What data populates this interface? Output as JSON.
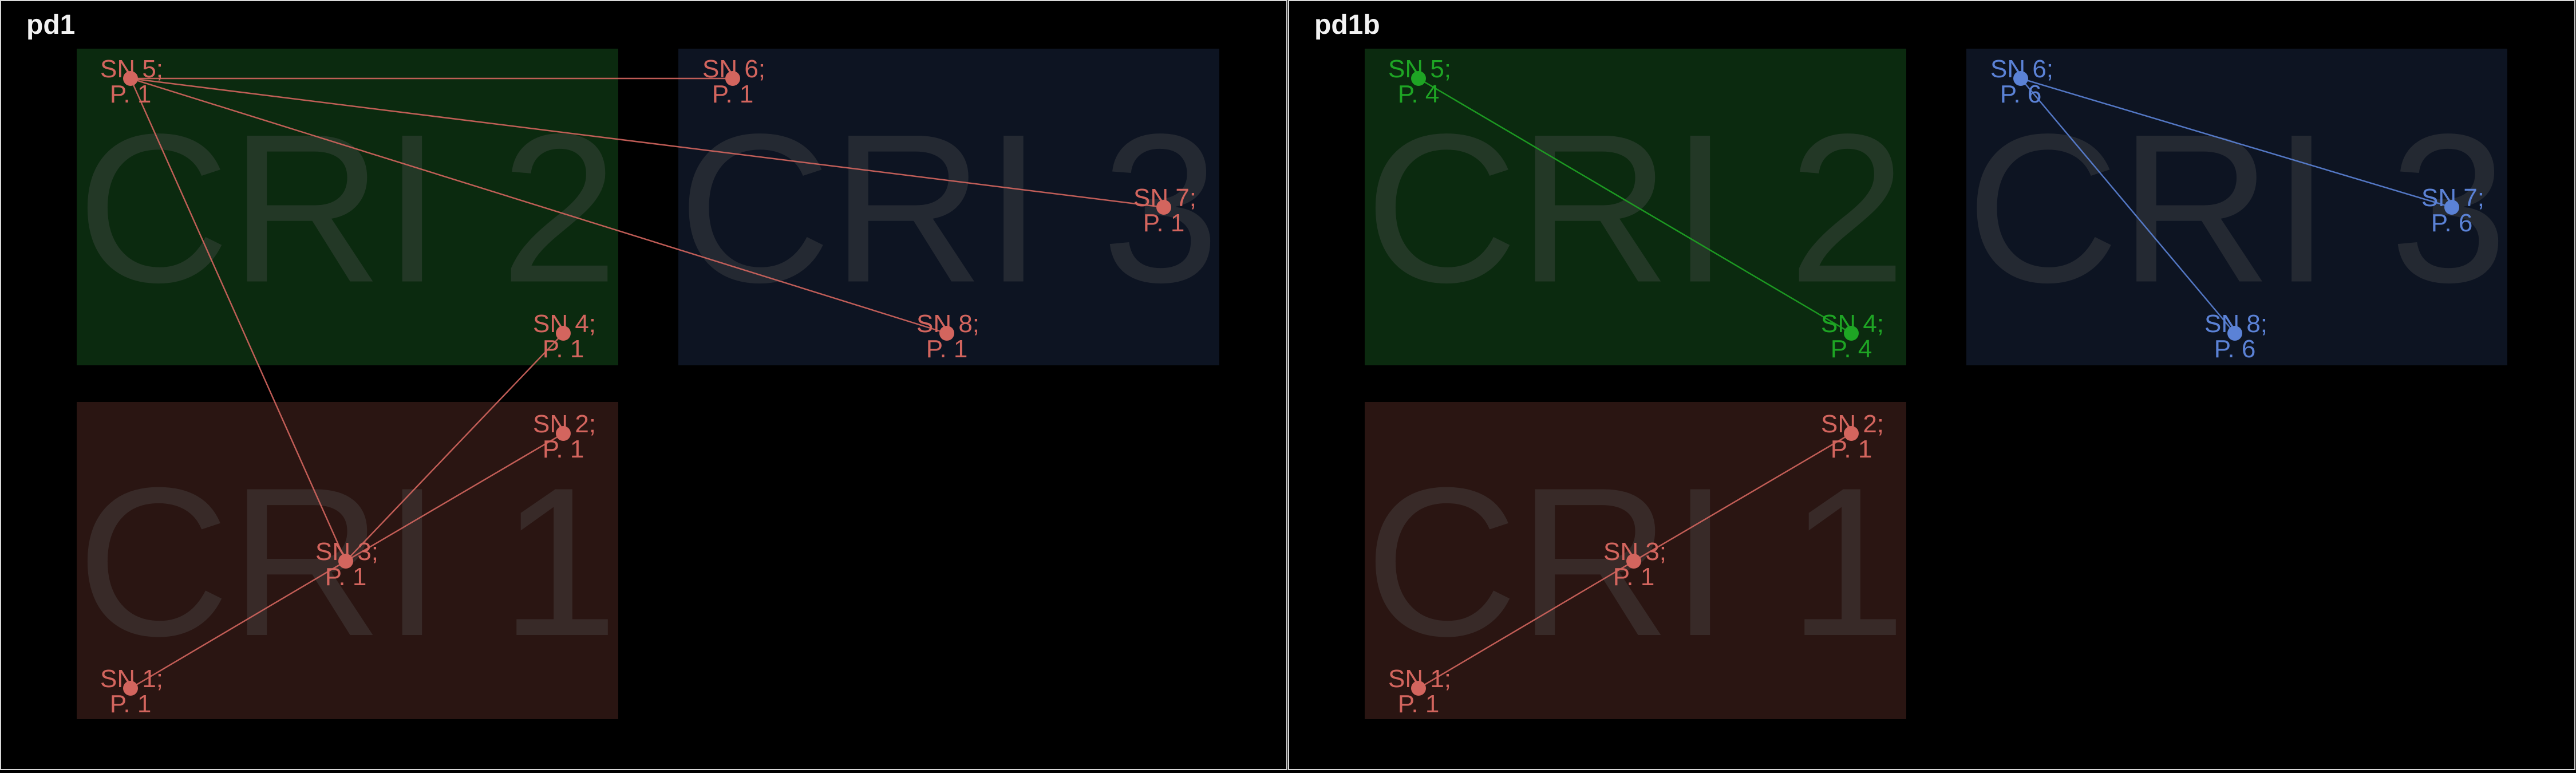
{
  "panels": [
    {
      "title": "pd1",
      "regions": [
        {
          "label": "CRI 2",
          "color": "#0b2a0f"
        },
        {
          "label": "CRI 3",
          "color": "#0d1422"
        },
        {
          "label": "CRI 1",
          "color": "#2a1512"
        }
      ],
      "nodes": [
        {
          "id": "SN 5",
          "line1": "SN 5;",
          "line2": "P. 1",
          "color": "#d3655e"
        },
        {
          "id": "SN 6",
          "line1": "SN 6;",
          "line2": "P. 1",
          "color": "#d3655e"
        },
        {
          "id": "SN 7",
          "line1": "SN 7;",
          "line2": "P. 1",
          "color": "#d3655e"
        },
        {
          "id": "SN 8",
          "line1": "SN 8;",
          "line2": "P. 1",
          "color": "#d3655e"
        },
        {
          "id": "SN 4",
          "line1": "SN 4;",
          "line2": "P. 1",
          "color": "#d3655e"
        },
        {
          "id": "SN 2",
          "line1": "SN 2;",
          "line2": "P. 1",
          "color": "#d3655e"
        },
        {
          "id": "SN 3",
          "line1": "SN 3;",
          "line2": "P. 1",
          "color": "#d3655e"
        },
        {
          "id": "SN 1",
          "line1": "SN 1;",
          "line2": "P. 1",
          "color": "#d3655e"
        }
      ],
      "edges": [
        {
          "from": "SN 5",
          "to": "SN 6",
          "color": "#d3655e"
        },
        {
          "from": "SN 5",
          "to": "SN 7",
          "color": "#d3655e"
        },
        {
          "from": "SN 5",
          "to": "SN 8",
          "color": "#d3655e"
        },
        {
          "from": "SN 5",
          "to": "SN 3",
          "color": "#d3655e"
        },
        {
          "from": "SN 3",
          "to": "SN 4",
          "color": "#d3655e"
        },
        {
          "from": "SN 3",
          "to": "SN 2",
          "color": "#d3655e"
        },
        {
          "from": "SN 3",
          "to": "SN 1",
          "color": "#d3655e"
        }
      ]
    },
    {
      "title": "pd1b",
      "regions": [
        {
          "label": "CRI 2",
          "color": "#0b2a0f"
        },
        {
          "label": "CRI 3",
          "color": "#0d1422"
        },
        {
          "label": "CRI 1",
          "color": "#2a1512"
        }
      ],
      "nodes": [
        {
          "id": "SN 5",
          "line1": "SN 5;",
          "line2": "P. 4",
          "color": "#1ea524"
        },
        {
          "id": "SN 4",
          "line1": "SN 4;",
          "line2": "P. 4",
          "color": "#1ea524"
        },
        {
          "id": "SN 6",
          "line1": "SN 6;",
          "line2": "P. 6",
          "color": "#5b82d6"
        },
        {
          "id": "SN 7",
          "line1": "SN 7;",
          "line2": "P. 6",
          "color": "#5b82d6"
        },
        {
          "id": "SN 8",
          "line1": "SN 8;",
          "line2": "P. 6",
          "color": "#5b82d6"
        },
        {
          "id": "SN 2",
          "line1": "SN 2;",
          "line2": "P. 1",
          "color": "#d3655e"
        },
        {
          "id": "SN 3",
          "line1": "SN 3;",
          "line2": "P. 1",
          "color": "#d3655e"
        },
        {
          "id": "SN 1",
          "line1": "SN 1;",
          "line2": "P. 1",
          "color": "#d3655e"
        }
      ],
      "edges": [
        {
          "from": "SN 5",
          "to": "SN 4",
          "color": "#1ea524"
        },
        {
          "from": "SN 6",
          "to": "SN 7",
          "color": "#5b82d6"
        },
        {
          "from": "SN 6",
          "to": "SN 8",
          "color": "#5b82d6"
        },
        {
          "from": "SN 3",
          "to": "SN 2",
          "color": "#d3655e"
        },
        {
          "from": "SN 3",
          "to": "SN 1",
          "color": "#d3655e"
        }
      ]
    }
  ]
}
